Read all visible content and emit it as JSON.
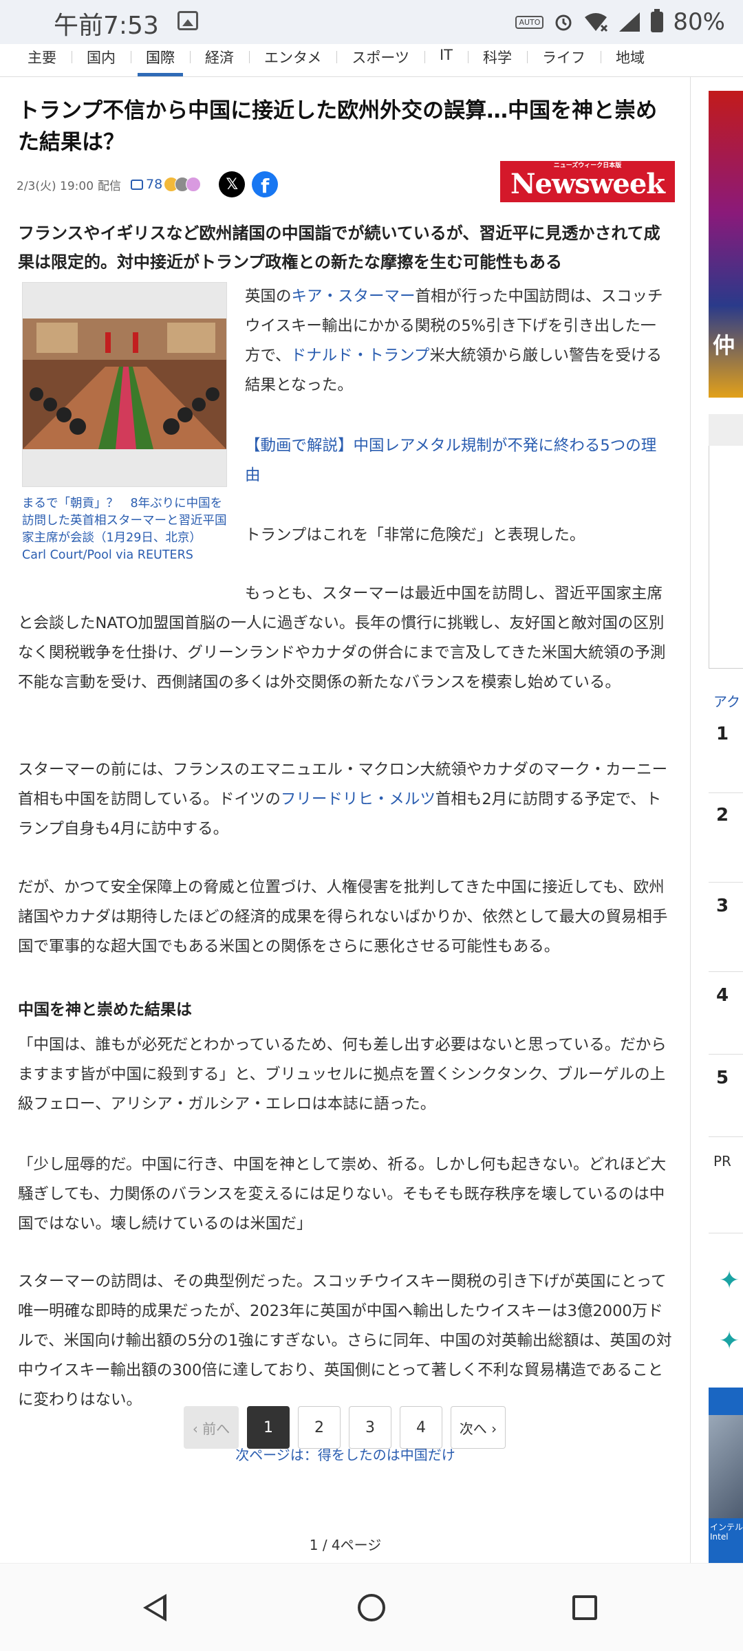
{
  "status_bar": {
    "time": "午前7:53",
    "auto_label": "AUTO",
    "battery": "80%"
  },
  "tabs": [
    "主要",
    "国内",
    "国際",
    "経済",
    "エンタメ",
    "スポーツ",
    "IT",
    "科学",
    "ライフ",
    "地域"
  ],
  "active_tab": "国際",
  "article": {
    "title": "トランプ不信から中国に接近した欧州外交の誤算…中国を神と崇めた結果は？",
    "date": "2/3(火) 19:00",
    "delivery": "配信",
    "comment_count": "78",
    "publisher_logo": "Newsweek",
    "publisher_logo_small": "ニューズウィーク日本版",
    "lead": "フランスやイギリスなど欧州諸国の中国詣でが続いているが、習近平に見透かされて成果は限定的。対中接近がトランプ政権との新たな摩擦を生む可能性もある",
    "photo_caption": "まるで「朝貢」？　8年ぶりに中国を訪問した英首相スターマーと習近平国家主席が会談（1月29日、北京）",
    "photo_credit": "Carl Court/Pool via REUTERS",
    "p1": {
      "a": "英国の",
      "link1": "キア・スターマー",
      "b": "首相が行った中国訪問は、スコッチウイスキー輸出にかかる関税の5%引き下げを引き出した一方で、",
      "link2": "ドナルド・トランプ",
      "c": "米大統領から厳しい警告を受ける結果となった。"
    },
    "video_link": "【動画で解説】中国レアメタル規制が不発に終わる5つの理由",
    "p2": "トランプはこれを「非常に危険だ」と表現した。",
    "p3": "もっとも、スターマーは最近中国を訪問し、習近平国家主席と会談したNATO加盟国首脳の一人に過ぎない。長年の慣行に挑戦し、友好国と敵対国の区別なく関税戦争を仕掛け、グリーンランドやカナダの併合にまで言及してきた米国大統領の予測不能な言動を受け、西側諸国の多くは外交関係の新たなバランスを模索し始めている。",
    "p4": {
      "a": "スターマーの前には、フランスのエマニュエル・マクロン大統領やカナダのマーク・カーニー首相も中国を訪問している。ドイツの",
      "link": "フリードリヒ・メルツ",
      "b": "首相も2月に訪問する予定で、トランプ自身も4月に訪中する。"
    },
    "p5": "だが、かつて安全保障上の脅威と位置づけ、人権侵害を批判してきた中国に接近しても、欧州諸国やカナダは期待したほどの経済的成果を得られないばかりか、依然として最大の貿易相手国で軍事的な超大国でもある米国との関係をさらに悪化させる可能性もある。",
    "subheading": "中国を神と崇めた結果は",
    "p6": "「中国は、誰もが必死だとわかっているため、何も差し出す必要はないと思っている。だからますます皆が中国に殺到する」と、ブリュッセルに拠点を置くシンクタンク、ブルーゲルの上級フェロー、アリシア・ガルシア・エレロは本誌に語った。",
    "p7": "「少し屈辱的だ。中国に行き、中国を神として崇め、祈る。しかし何も起きない。どれほど大騒ぎしても、力関係のバランスを変えるには足りない。そもそも既存秩序を壊しているのは中国ではない。壊し続けているのは米国だ」",
    "p8": "スターマーの訪問は、その典型例だった。スコッチウイスキー関税の引き下げが英国にとって唯一明確な即時的成果だったが、2023年に英国が中国へ輸出したウイスキーは3億2000万ドルで、米国向け輸出額の5分の1強にすぎない。さらに同年、中国の対英輸出総額は、英国の対中ウイスキー輸出額の300倍に達しており、英国側にとって著しく不利な貿易構造であることに変わりはない。"
  },
  "pagination": {
    "next_page_link": "次ページは：得をしたのは中国だけ",
    "prev": "‹ 前へ",
    "pages": [
      "1",
      "2",
      "3",
      "4"
    ],
    "current": "1",
    "next": "次へ ›",
    "page_count": "1 / 4ページ"
  },
  "sidebar": {
    "ad_text": "仲",
    "section_label": "アク",
    "ranks": [
      "1",
      "2",
      "3",
      "4",
      "5"
    ],
    "pr_label": "PR",
    "ad2_text": "インテル Intel"
  },
  "icons": {
    "gallery": "image-icon",
    "alarm": "alarm-icon",
    "wifi": "wifi-icon",
    "signal": "signal-icon",
    "battery": "battery-icon",
    "comment": "comment-icon",
    "x": "x-share-icon",
    "facebook": "facebook-share-icon",
    "back": "back-icon",
    "home": "home-icon",
    "recent": "recent-apps-icon"
  },
  "colors": {
    "link": "#2a5db0",
    "tab_accent": "#2f6bb7",
    "newsweek_red": "#d4182a"
  }
}
